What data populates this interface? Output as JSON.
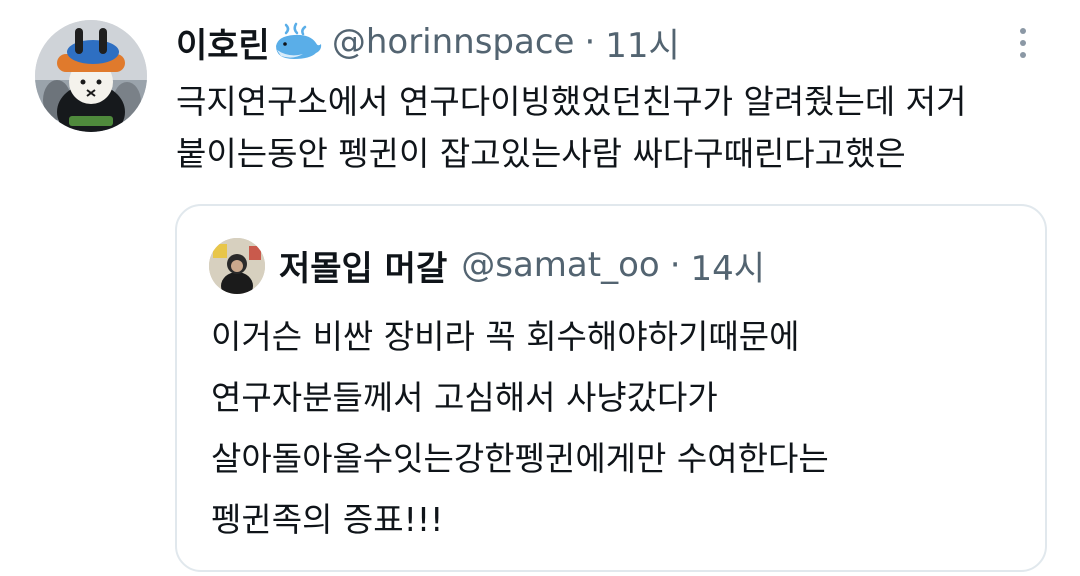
{
  "tweet": {
    "display_name": "이호린",
    "name_emoji": "whale-emoji",
    "handle": "@horinnspace",
    "separator": "·",
    "time": "11시",
    "menu_icon": "more-vertical-icon",
    "text_lines": [
      "극지연구소에서 연구다이빙했었던친구가 알려줬는데 저거",
      "붙이는동안 펭귄이 잡고있는사람 싸다구때린다고했은"
    ]
  },
  "quote": {
    "display_name": "저몰입 머갈",
    "handle": "@samat_oo",
    "separator": "·",
    "time": "14시",
    "text_lines": [
      "이거슨 비싼 장비라 꼭 회수해야하기때문에",
      "연구자분들께서 고심해서 사냥갔다가",
      "살아돌아올수잇는강한펭귄에게만 수여한다는",
      "펭귄족의 증표!!!"
    ]
  },
  "colors": {
    "text": "#0f1419",
    "secondary": "#536471",
    "border": "#e1e8ed",
    "whale": "#5aaee8"
  }
}
